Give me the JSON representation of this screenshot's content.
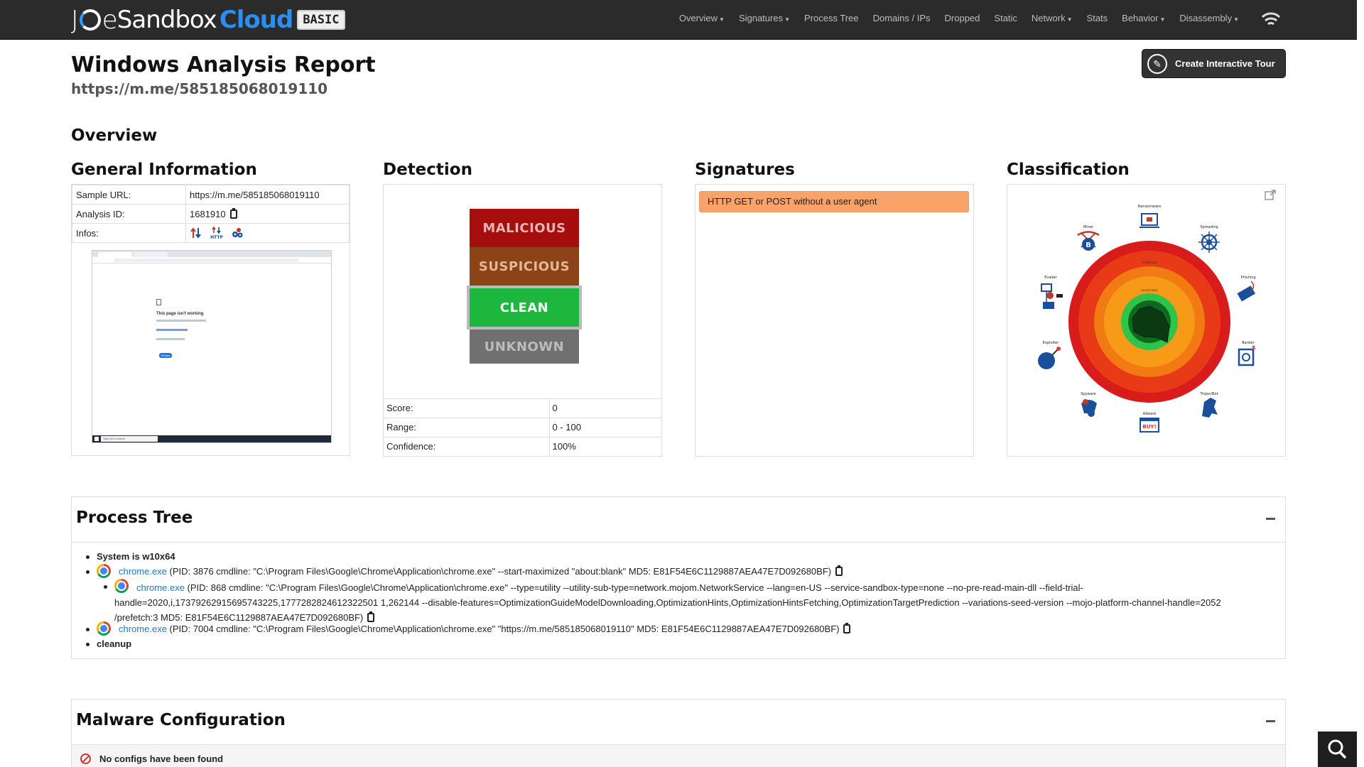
{
  "nav": {
    "logo": {
      "joe_prefix": "J",
      "joe_suffix": "e",
      "sandbox": "Sandbox",
      "cloud": "Cloud",
      "edition": "BASIC"
    },
    "items": [
      {
        "label": "Overview",
        "dropdown": true
      },
      {
        "label": "Signatures",
        "dropdown": true
      },
      {
        "label": "Process Tree",
        "dropdown": false
      },
      {
        "label": "Domains / IPs",
        "dropdown": false
      },
      {
        "label": "Dropped",
        "dropdown": false
      },
      {
        "label": "Static",
        "dropdown": false
      },
      {
        "label": "Network",
        "dropdown": true
      },
      {
        "label": "Stats",
        "dropdown": false
      },
      {
        "label": "Behavior",
        "dropdown": true
      },
      {
        "label": "Disassembly",
        "dropdown": true
      }
    ],
    "icon": "signal-icon"
  },
  "header": {
    "title": "Windows Analysis Report",
    "subtitle": "https://m.me/585185068019110",
    "tour_button": "Create Interactive Tour"
  },
  "overview": {
    "heading": "Overview",
    "general": {
      "heading": "General Information",
      "rows": [
        {
          "label": "Sample URL:",
          "value": "https://m.me/585185068019110"
        },
        {
          "label": "Analysis ID:",
          "value": "1681910"
        },
        {
          "label": "Infos:",
          "value": ""
        }
      ],
      "info_icons": [
        "network-arrows-icon",
        "http-icon",
        "process-icon"
      ],
      "screenshot": {
        "heading": "This page isn't working",
        "lines": [
          "",
          "",
          ""
        ],
        "button": "Reload",
        "taskbar_search": "Type here to search"
      }
    },
    "detection": {
      "heading": "Detection",
      "levels": [
        "MALICIOUS",
        "SUSPICIOUS",
        "CLEAN",
        "UNKNOWN"
      ],
      "active": "CLEAN",
      "rows": [
        {
          "label": "Score:",
          "value": "0"
        },
        {
          "label": "Range:",
          "value": "0 - 100"
        },
        {
          "label": "Confidence:",
          "value": "100%"
        }
      ]
    },
    "signatures": {
      "heading": "Signatures",
      "items": [
        "HTTP GET or POST without a user agent"
      ]
    },
    "classification": {
      "heading": "Classification",
      "categories": [
        "Ransomware",
        "Spreading",
        "Phishing",
        "Banker",
        "Trojan/Bot",
        "Adware",
        "Spyware",
        "Exploiter",
        "Evader",
        "Miner"
      ],
      "ring_labels": [
        "malicious",
        "suspicious",
        "clean"
      ],
      "expand_icon": "expand-icon"
    }
  },
  "process_tree": {
    "heading": "Process Tree",
    "system": "System is w10x64",
    "processes": [
      {
        "name": "chrome.exe",
        "detail": "(PID: 3876 cmdline: \"C:\\Program Files\\Google\\Chrome\\Application\\chrome.exe\" --start-maximized \"about:blank\" MD5: E81F54E6C1129887AEA47E7D092680BF)",
        "level": 0
      },
      {
        "name": "chrome.exe",
        "detail": "(PID: 868 cmdline: \"C:\\Program Files\\Google\\Chrome\\Application\\chrome.exe\" --type=utility --utility-sub-type=network.mojom.NetworkService --lang=en-US --service-sandbox-type=none --no-pre-read-main-dll --field-trial-handle=2020,i,17379262915695743225,1777282824612322501 1,262144 --disable-features=OptimizationGuideModelDownloading,OptimizationHints,OptimizationHintsFetching,OptimizationTargetPrediction --variations-seed-version --mojo-platform-channel-handle=2052 /prefetch:3 MD5: E81F54E6C1129887AEA47E7D092680BF)",
        "level": 1
      },
      {
        "name": "chrome.exe",
        "detail": "(PID: 7004 cmdline: \"C:\\Program Files\\Google\\Chrome\\Application\\chrome.exe\" \"https://m.me/585185068019110\" MD5: E81F54E6C1129887AEA47E7D092680BF)",
        "level": 0
      }
    ],
    "cleanup": "cleanup"
  },
  "malware_config": {
    "heading": "Malware Configuration",
    "message": "No configs have been found"
  },
  "colors": {
    "navbar": "#2b2b2b",
    "malicious": "#a60d0d",
    "suspicious": "#8c4315",
    "clean": "#1db73e",
    "unknown": "#707070",
    "signature_bg": "#f9a26a",
    "link": "#1a7ac7"
  }
}
